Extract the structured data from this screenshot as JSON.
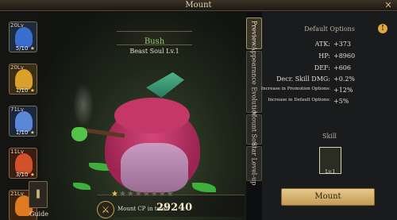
{
  "window": {
    "title": "Mount",
    "close_icon": "close-x-icon"
  },
  "heroes": [
    {
      "level": "20Lv",
      "count": "5/10",
      "color": "#3a6fd0"
    },
    {
      "level": "20Lv",
      "count": "1/10",
      "color": "#d9a02b"
    },
    {
      "level": "71Lv",
      "count": "1/10",
      "color": "#5b88d6"
    },
    {
      "level": "11Lv",
      "count": "3/10",
      "color": "#d0512a"
    },
    {
      "level": "21Lv",
      "count": "",
      "color": "#e07a20"
    }
  ],
  "mount": {
    "name": "Bush",
    "soul": "Beast Soul Lv.1",
    "stars_lit": 1,
    "stars_total": 8
  },
  "cp": {
    "label": "Mount CP in total:",
    "value": "29240"
  },
  "guide": {
    "label": "Guide"
  },
  "tabs": [
    {
      "label": "Preview",
      "active": true
    },
    {
      "label": "Appearance Evolution",
      "active": false
    },
    {
      "label": "Mount Soul",
      "active": false
    },
    {
      "label": "Star Level-up",
      "active": false
    }
  ],
  "options": {
    "title": "Default Options",
    "stats": [
      {
        "key": "ATK:",
        "value": "+373"
      },
      {
        "key": "HP:",
        "value": "+8960"
      },
      {
        "key": "DEF:",
        "value": "+606"
      },
      {
        "key": "Decr. Skill DMG:",
        "value": "+0.2%"
      },
      {
        "key": "Increase in Promotion Options:",
        "value": "+12%"
      },
      {
        "key": "Increase in Default Options:",
        "value": "+5%"
      }
    ]
  },
  "skill": {
    "title": "Skill",
    "level": "Lv.1"
  },
  "actions": {
    "mount_label": "Mount"
  },
  "colors": {
    "accent_gold": "#c39a54",
    "name_green": "#8fcf6a",
    "toad_red": "#c33866"
  }
}
